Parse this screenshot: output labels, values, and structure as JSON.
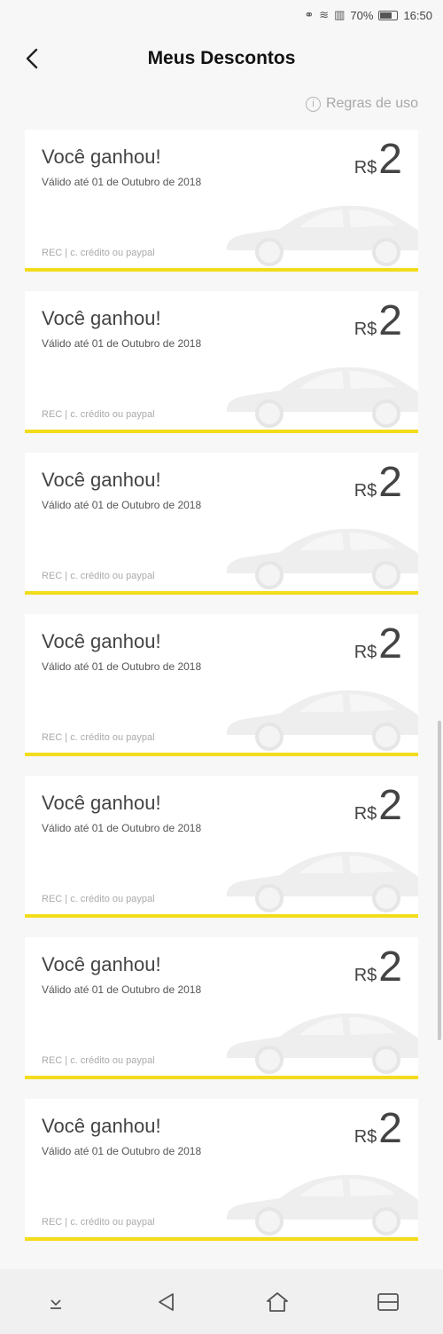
{
  "status_bar": {
    "battery": "70%",
    "time": "16:50"
  },
  "header": {
    "title": "Meus Descontos"
  },
  "rules": {
    "label": "Regras de uso"
  },
  "coupons": [
    {
      "title": "Você ganhou!",
      "validity": "Válido até 01 de Outubro de 2018",
      "currency": "R$",
      "amount": "2",
      "method": "REC | c. crédito ou paypal"
    },
    {
      "title": "Você ganhou!",
      "validity": "Válido até 01 de Outubro de 2018",
      "currency": "R$",
      "amount": "2",
      "method": "REC | c. crédito ou paypal"
    },
    {
      "title": "Você ganhou!",
      "validity": "Válido até 01 de Outubro de 2018",
      "currency": "R$",
      "amount": "2",
      "method": "REC | c. crédito ou paypal"
    },
    {
      "title": "Você ganhou!",
      "validity": "Válido até 01 de Outubro de 2018",
      "currency": "R$",
      "amount": "2",
      "method": "REC | c. crédito ou paypal"
    },
    {
      "title": "Você ganhou!",
      "validity": "Válido até 01 de Outubro de 2018",
      "currency": "R$",
      "amount": "2",
      "method": "REC | c. crédito ou paypal"
    },
    {
      "title": "Você ganhou!",
      "validity": "Válido até 01 de Outubro de 2018",
      "currency": "R$",
      "amount": "2",
      "method": "REC | c. crédito ou paypal"
    },
    {
      "title": "Você ganhou!",
      "validity": "Válido até 01 de Outubro de 2018",
      "currency": "R$",
      "amount": "2",
      "method": "REC | c. crédito ou paypal"
    }
  ],
  "colors": {
    "accent_yellow": "#f2dc1c",
    "background": "#f7f7f7",
    "card": "#ffffff"
  },
  "icons": {
    "back": "chevron-left-icon",
    "info": "info-icon",
    "car": "car-icon",
    "nav": [
      "hide-keyboard-icon",
      "back-triangle-icon",
      "home-icon",
      "recents-icon"
    ]
  }
}
